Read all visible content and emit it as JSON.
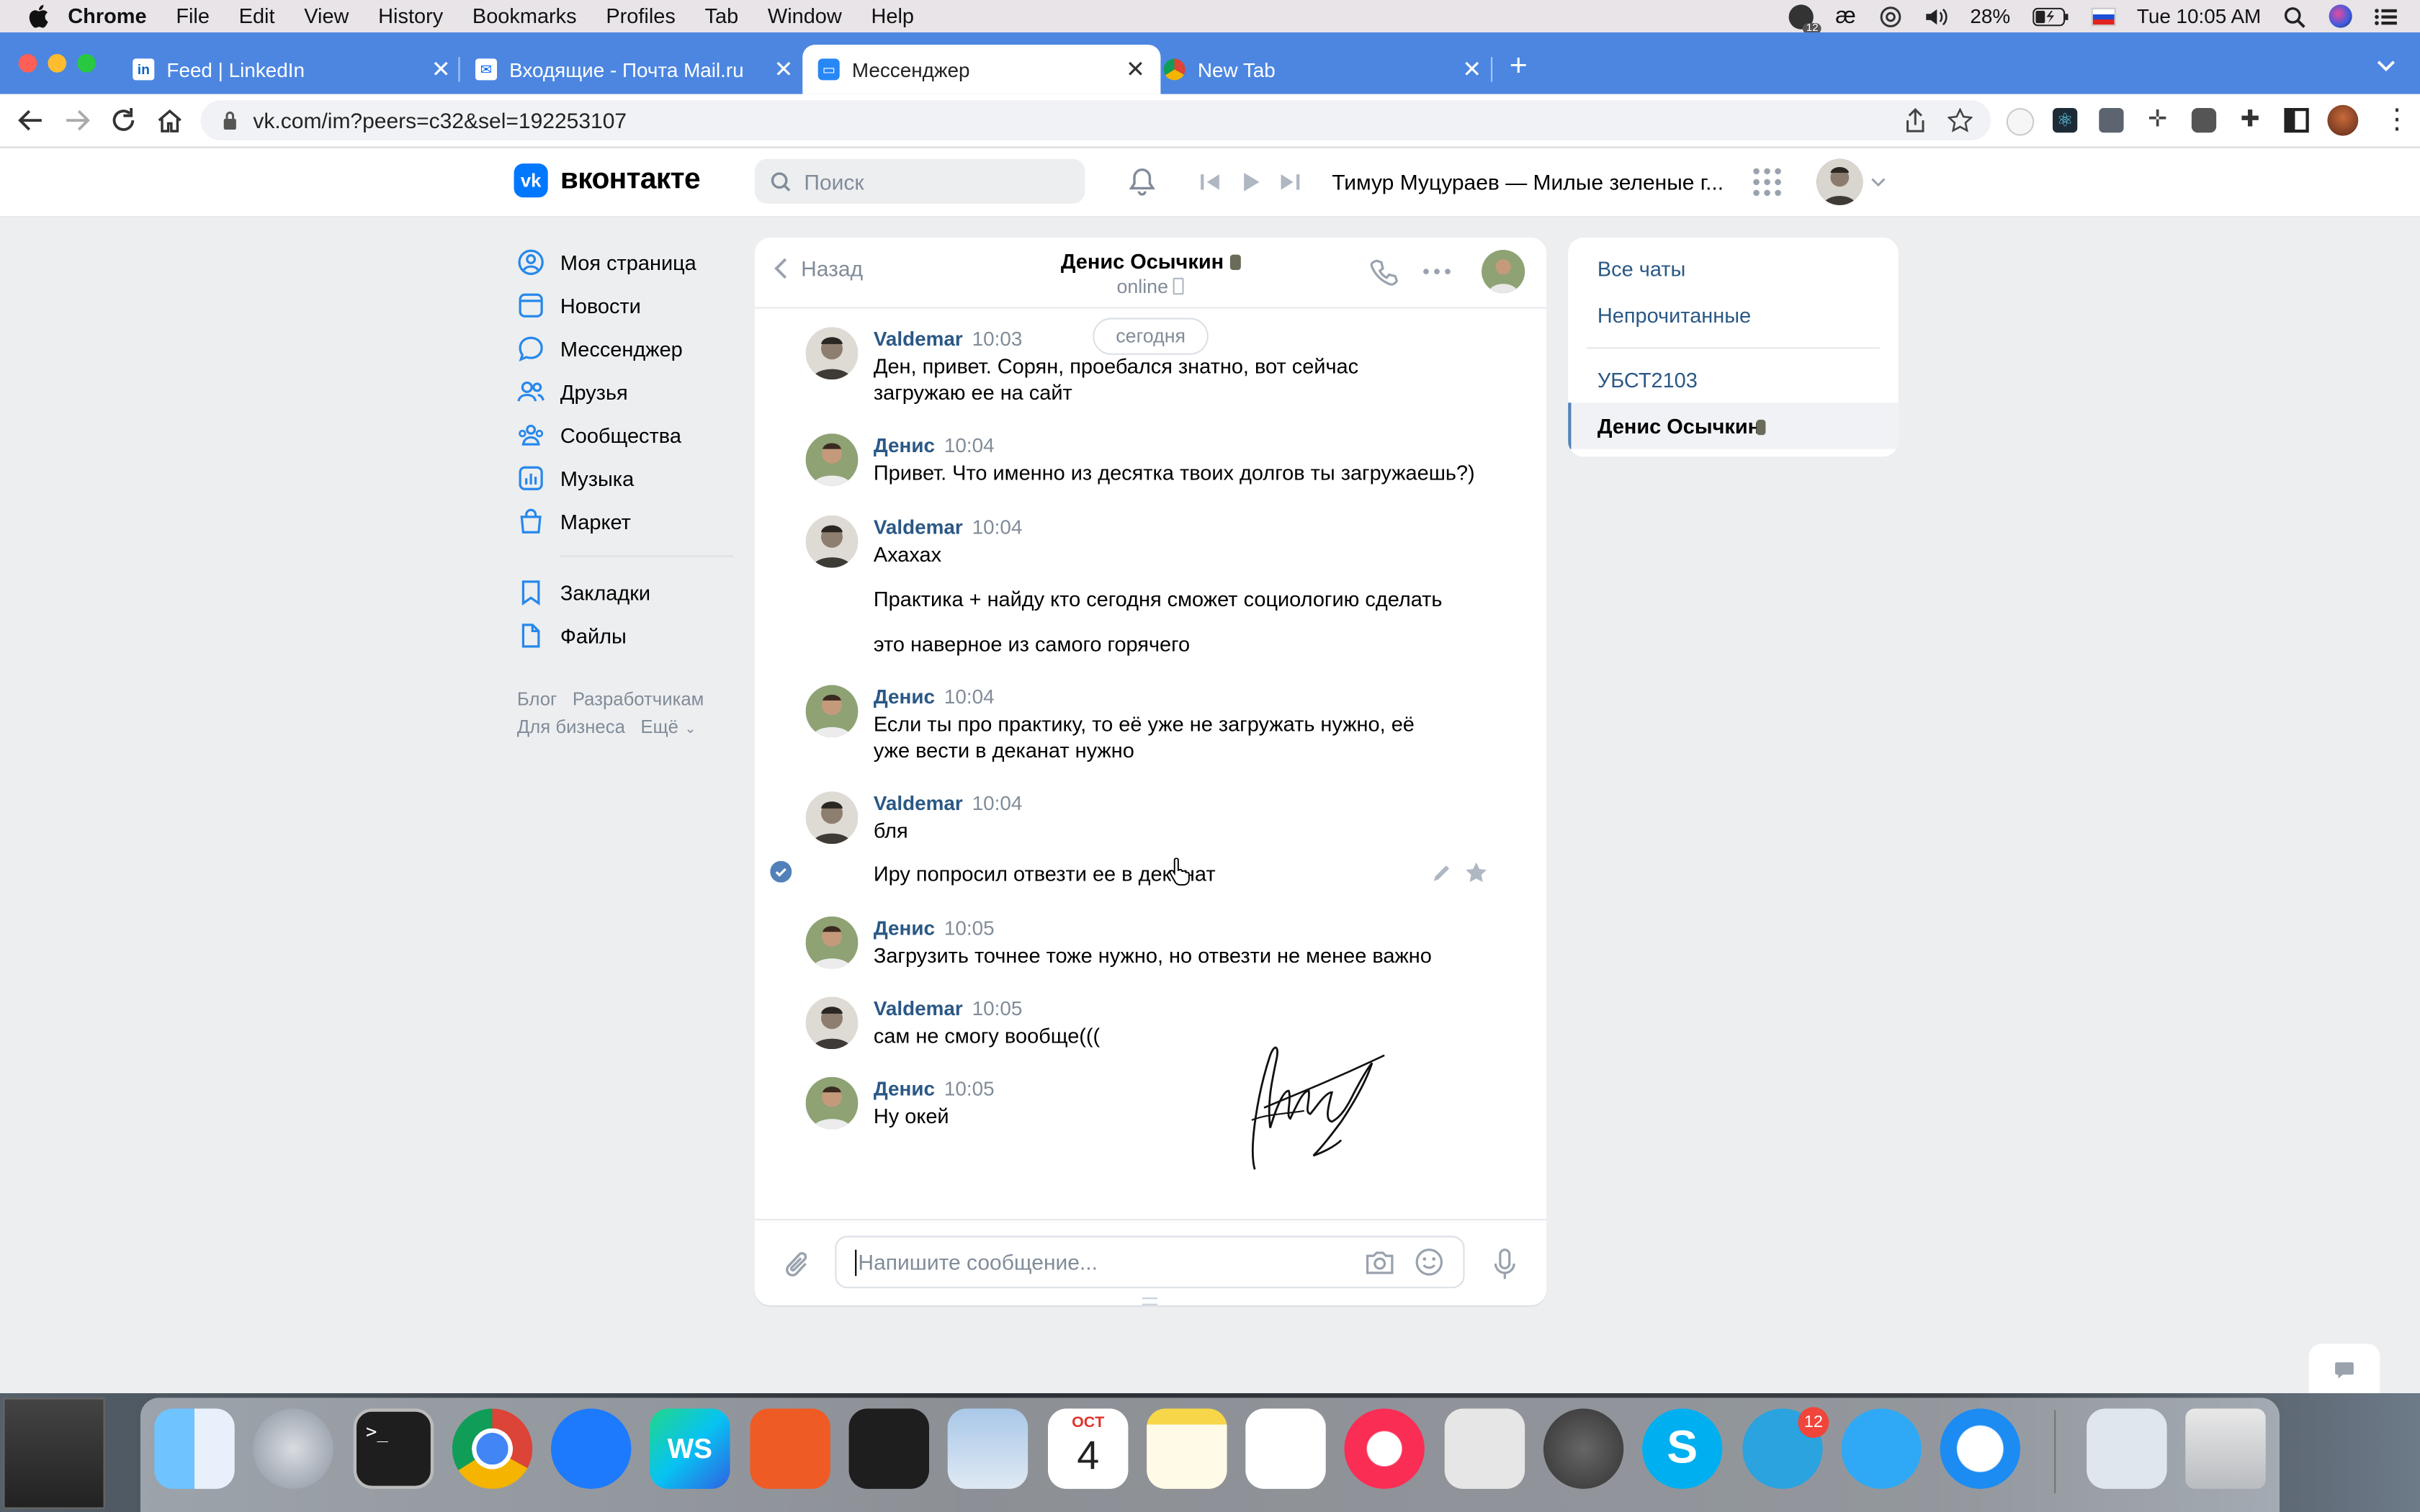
{
  "menubar": {
    "app": "Chrome",
    "items": [
      "File",
      "Edit",
      "View",
      "History",
      "Bookmarks",
      "Profiles",
      "Tab",
      "Window",
      "Help"
    ],
    "battery": "28%",
    "clock": "Tue 10:05 AM",
    "badge": "12"
  },
  "tabs": [
    {
      "title": "Feed | LinkedIn",
      "icon": "linkedin-icon",
      "active": false
    },
    {
      "title": "Входящие - Почта Mail.ru",
      "icon": "mail-icon",
      "active": false
    },
    {
      "title": "Мессенджер",
      "icon": "vk-messenger-icon",
      "active": true
    },
    {
      "title": "New Tab",
      "icon": "chrome-icon",
      "active": false
    }
  ],
  "address": {
    "url": "vk.com/im?peers=c32&sel=192253107"
  },
  "vk": {
    "logo_text": "вконтакте",
    "search_placeholder": "Поиск",
    "now_playing": "Тимур Муцураев — Милые зеленые г..."
  },
  "leftnav": {
    "items": [
      "Моя страница",
      "Новости",
      "Мессенджер",
      "Друзья",
      "Сообщества",
      "Музыка",
      "Маркет"
    ],
    "items2": [
      "Закладки",
      "Файлы"
    ],
    "footer": [
      "Блог",
      "Разработчикам",
      "Для бизнеса",
      "Ещё"
    ]
  },
  "chat": {
    "back": "Назад",
    "title": "Денис Осычкин",
    "status": "online",
    "date_chip": "сегодня",
    "messages": [
      {
        "author": "Valdemar",
        "time": "10:03",
        "text": "Ден, привет. Сорян, проебался знатно, вот сейчас загружаю ее на сайт"
      },
      {
        "author": "Денис",
        "time": "10:04",
        "text": "Привет. Что именно из десятка твоих долгов ты загружаешь?)"
      },
      {
        "author": "Valdemar",
        "time": "10:04",
        "text": "Ахахах",
        "more": [
          "Практика + найду кто сегодня сможет социологию сделать",
          "это наверное из самого горячего"
        ]
      },
      {
        "author": "Денис",
        "time": "10:04",
        "text": "Если ты про практику, то её уже не загружать нужно, её уже вести в деканат нужно"
      },
      {
        "author": "Valdemar",
        "time": "10:04",
        "text": "бля",
        "more": [
          "Иру попросил отвезти ее в деканат"
        ]
      },
      {
        "author": "Денис",
        "time": "10:05",
        "text": "Загрузить точнее тоже нужно, но отвезти не менее важно"
      },
      {
        "author": "Valdemar",
        "time": "10:05",
        "text": "сам не смогу вообще((("
      },
      {
        "author": "Денис",
        "time": "10:05",
        "text": "Ну окей"
      }
    ],
    "input_placeholder": "Напишите сообщение..."
  },
  "rightpanel": {
    "filters": [
      "Все чаты",
      "Непрочитанные"
    ],
    "chats": [
      "УБСТ2103",
      "Денис Осычкин"
    ]
  },
  "dock": {
    "calendar_month": "OCT",
    "calendar_day": "4",
    "telegram_badge": "12",
    "apps": [
      "finder-icon",
      "launchpad-icon",
      "terminal-icon",
      "chrome-icon",
      "sourcetree-icon",
      "webstorm-icon",
      "postman-icon",
      "figma-icon",
      "mail-icon",
      "calendar-icon",
      "notes-icon",
      "reminders-icon",
      "music-icon",
      "screenshot-icon",
      "settings-icon",
      "skype-icon",
      "telegram-icon",
      "messages-icon",
      "safari-icon",
      "documents-icon",
      "trash-icon"
    ]
  }
}
